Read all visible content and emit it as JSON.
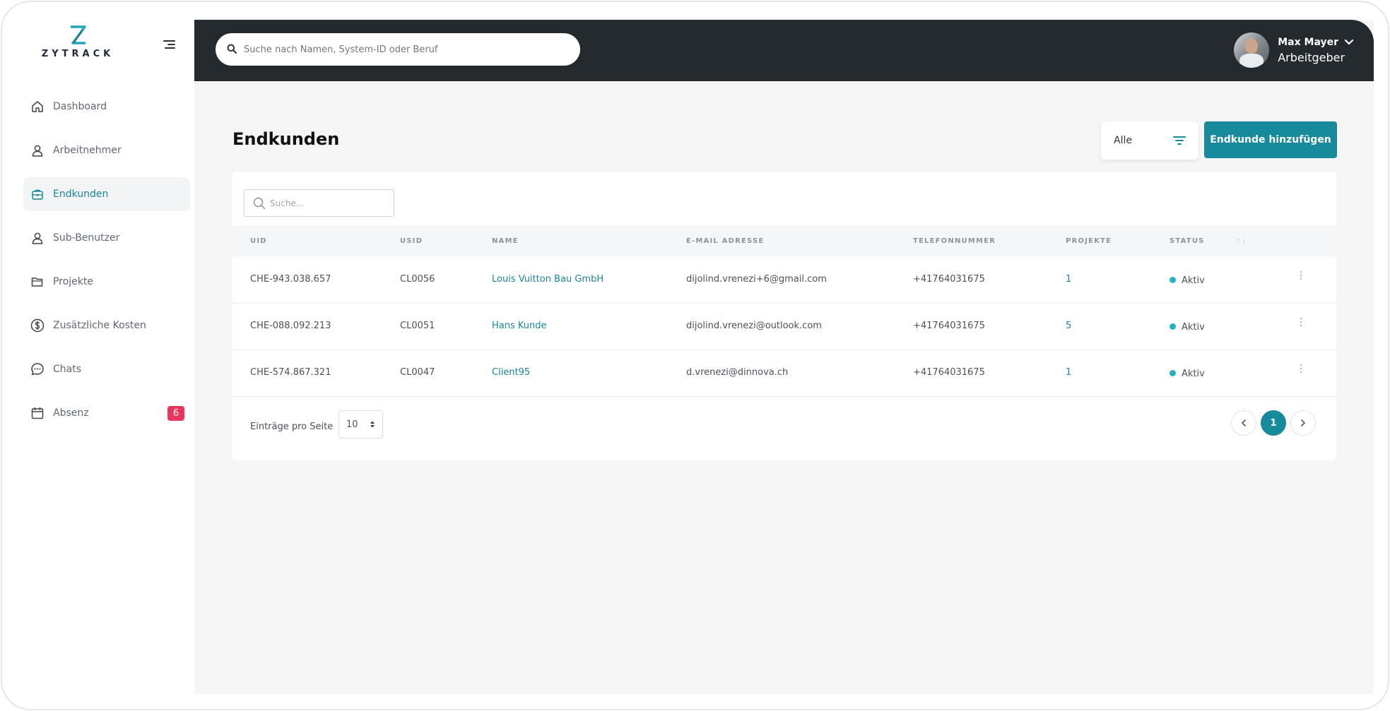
{
  "app": {
    "logo_text": "ZYTRACK"
  },
  "sidebar": {
    "items": [
      {
        "label": "Dashboard",
        "icon": "home-icon"
      },
      {
        "label": "Arbeitnehmer",
        "icon": "user-icon"
      },
      {
        "label": "Endkunden",
        "icon": "briefcase-icon",
        "active": true
      },
      {
        "label": "Sub-Benutzer",
        "icon": "user-icon"
      },
      {
        "label": "Projekte",
        "icon": "folder-icon"
      },
      {
        "label": "Zusätzliche Kosten",
        "icon": "dollar-icon"
      },
      {
        "label": "Chats",
        "icon": "chat-icon"
      },
      {
        "label": "Absenz",
        "icon": "calendar-icon",
        "badge": "6"
      }
    ]
  },
  "header": {
    "search_placeholder": "Suche nach Namen, System-ID oder Beruf",
    "user_name": "Max Mayer",
    "user_role": "Arbeitgeber"
  },
  "page": {
    "title": "Endkunden",
    "filter_value": "Alle",
    "add_button": "Endkunde hinzufügen",
    "table_search_placeholder": "Suche..."
  },
  "table": {
    "columns": [
      "UID",
      "USID",
      "NAME",
      "E-MAIL ADRESSE",
      "TELEFONNUMMER",
      "PROJEKTE",
      "STATUS"
    ],
    "rows": [
      {
        "uid": "CHE-943.038.657",
        "usid": "CL0056",
        "name": "Louis Vuitton Bau GmbH",
        "email": "dijolind.vrenezi+6@gmail.com",
        "phone": "+41764031675",
        "projects": "1",
        "status": "Aktiv"
      },
      {
        "uid": "CHE-088.092.213",
        "usid": "CL0051",
        "name": "Hans Kunde",
        "email": "dijolind.vrenezi@outlook.com",
        "phone": "+41764031675",
        "projects": "5",
        "status": "Aktiv"
      },
      {
        "uid": "CHE-574.867.321",
        "usid": "CL0047",
        "name": "Client95",
        "email": "d.vrenezi@dinnova.ch",
        "phone": "+41764031675",
        "projects": "1",
        "status": "Aktiv"
      }
    ]
  },
  "pagination": {
    "per_page_label": "Einträge pro Seite",
    "per_page_value": "10",
    "current_page": "1"
  },
  "colors": {
    "accent": "#178a9b",
    "header_bg": "#24292d",
    "badge": "#e8365d",
    "status_active": "#22b3c3"
  }
}
